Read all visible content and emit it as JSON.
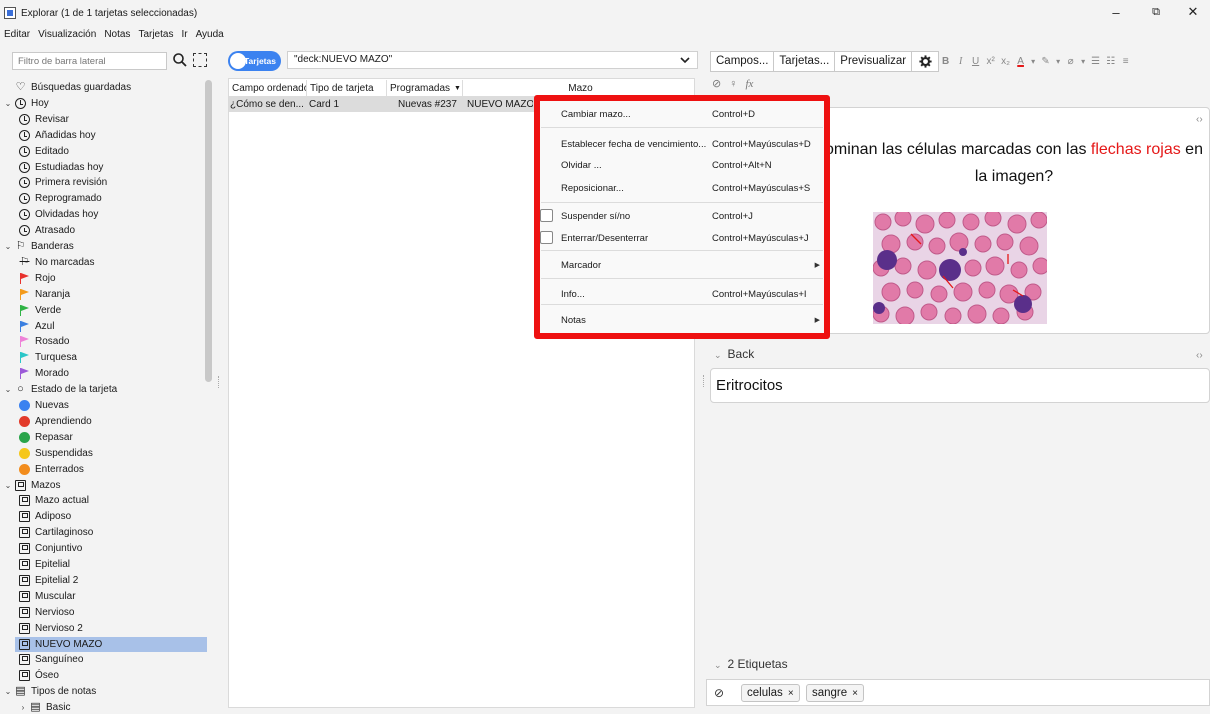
{
  "window": {
    "title": "Explorar (1 de 1 tarjetas seleccionadas)",
    "controls": {
      "minimize": "–",
      "maximize": "⧉",
      "close": "✕"
    }
  },
  "menubar": [
    "Editar",
    "Visualización",
    "Notas",
    "Tarjetas",
    "Ir",
    "Ayuda"
  ],
  "sidebar": {
    "filter_placeholder": "Filtro de barra lateral",
    "items": [
      {
        "label": "Búsquedas guardadas",
        "icon": "heart-icon",
        "level": 0
      },
      {
        "label": "Hoy",
        "icon": "clock-icon",
        "level": 0,
        "expandable": true
      },
      {
        "label": "Revisar",
        "icon": "clock-icon",
        "level": 1
      },
      {
        "label": "Añadidas hoy",
        "icon": "clock-icon",
        "level": 1
      },
      {
        "label": "Editado",
        "icon": "clock-icon",
        "level": 1
      },
      {
        "label": "Estudiadas hoy",
        "icon": "clock-icon",
        "level": 1
      },
      {
        "label": "Primera revisión",
        "icon": "clock-icon",
        "level": 1
      },
      {
        "label": "Reprogramado",
        "icon": "clock-icon",
        "level": 1
      },
      {
        "label": "Olvidadas hoy",
        "icon": "clock-icon",
        "level": 1
      },
      {
        "label": "Atrasado",
        "icon": "clock-icon",
        "level": 1
      },
      {
        "label": "Banderas",
        "icon": "flag-outline-icon",
        "level": 0,
        "expandable": true
      },
      {
        "label": "No marcadas",
        "icon": "no-flag-icon",
        "level": 1
      },
      {
        "label": "Rojo",
        "icon": "flag-icon",
        "color": "#e8322e",
        "level": 1
      },
      {
        "label": "Naranja",
        "icon": "flag-icon",
        "color": "#f39a1a",
        "level": 1
      },
      {
        "label": "Verde",
        "icon": "flag-icon",
        "color": "#2fb344",
        "level": 1
      },
      {
        "label": "Azul",
        "icon": "flag-icon",
        "color": "#3a7fe0",
        "level": 1
      },
      {
        "label": "Rosado",
        "icon": "flag-icon",
        "color": "#ee82d8",
        "level": 1
      },
      {
        "label": "Turquesa",
        "icon": "flag-icon",
        "color": "#2bc6c8",
        "level": 1
      },
      {
        "label": "Morado",
        "icon": "flag-icon",
        "color": "#9b5ad8",
        "level": 1
      },
      {
        "label": "Estado de la tarjeta",
        "icon": "circle-icon",
        "level": 0,
        "expandable": true
      },
      {
        "label": "Nuevas",
        "icon": "dot-icon",
        "color": "#3b82f0",
        "level": 1
      },
      {
        "label": "Aprendiendo",
        "icon": "dot-icon",
        "color": "#e23a2a",
        "level": 1
      },
      {
        "label": "Repasar",
        "icon": "dot-icon",
        "color": "#2aa44a",
        "level": 1
      },
      {
        "label": "Suspendidas",
        "icon": "dot-icon",
        "color": "#f5c71a",
        "level": 1
      },
      {
        "label": "Enterrados",
        "icon": "dot-icon",
        "color": "#f28c1c",
        "level": 1
      },
      {
        "label": "Mazos",
        "icon": "deck-icon",
        "level": 0,
        "expandable": true
      },
      {
        "label": "Mazo actual",
        "icon": "current-deck-icon",
        "level": 1
      },
      {
        "label": "Adiposo",
        "icon": "deck-icon",
        "level": 1
      },
      {
        "label": "Cartilaginoso",
        "icon": "deck-icon",
        "level": 1
      },
      {
        "label": "Conjuntivo",
        "icon": "deck-icon",
        "level": 1
      },
      {
        "label": "Epitelial",
        "icon": "deck-icon",
        "level": 1
      },
      {
        "label": "Epitelial 2",
        "icon": "deck-icon",
        "level": 1
      },
      {
        "label": "Muscular",
        "icon": "deck-icon",
        "level": 1
      },
      {
        "label": "Nervioso",
        "icon": "deck-icon",
        "level": 1
      },
      {
        "label": "Nervioso 2",
        "icon": "deck-icon",
        "level": 1
      },
      {
        "label": "NUEVO MAZO",
        "icon": "deck-icon",
        "level": 1,
        "selected": true
      },
      {
        "label": "Sanguíneo",
        "icon": "deck-icon",
        "level": 1
      },
      {
        "label": "Óseo",
        "icon": "deck-icon",
        "level": 1
      },
      {
        "label": "Tipos de notas",
        "icon": "note-type-icon",
        "level": 0,
        "expandable": true
      },
      {
        "label": "Basic",
        "icon": "note-type-icon",
        "level": 1,
        "collapsed": true
      }
    ]
  },
  "browser": {
    "mode_toggle": "Tarjetas",
    "search_query": "\"deck:NUEVO MAZO\"",
    "columns": [
      "Campo ordenado",
      "Tipo de tarjeta",
      "Programadas",
      "Mazo"
    ],
    "sort_indicator": "▼",
    "row": {
      "sort_field": "¿Cómo se den...",
      "card_type": "Card 1",
      "due": "Nuevas #237",
      "deck": "NUEVO MAZO"
    }
  },
  "context_menu": {
    "items": [
      {
        "label": "Cambiar mazo...",
        "shortcut": "Control+D"
      },
      {
        "label": "Establecer fecha de vencimiento...",
        "shortcut": "Control+Mayúsculas+D"
      },
      {
        "label": "Olvidar ...",
        "shortcut": "Control+Alt+N"
      },
      {
        "label": "Reposicionar...",
        "shortcut": "Control+Mayúsculas+S"
      },
      {
        "label": "Suspender sí/no",
        "shortcut": "Control+J",
        "checkbox": true
      },
      {
        "label": "Enterrar/Desenterrar",
        "shortcut": "Control+Mayúsculas+J",
        "checkbox": true
      },
      {
        "label": "Marcador",
        "shortcut": "",
        "submenu": true
      },
      {
        "label": "Info...",
        "shortcut": "Control+Mayúsculas+I"
      },
      {
        "label": "Notas",
        "shortcut": "",
        "submenu": true
      }
    ],
    "highlight_color": "#ee1111"
  },
  "editor": {
    "buttons": [
      "Campos...",
      "Tarjetas...",
      "Previsualizar"
    ],
    "format_glyphs": [
      "B",
      "I",
      "U",
      "x²",
      "x₂",
      "A",
      "▾",
      "✎",
      "▾",
      "⌀",
      "▾",
      "☰",
      "☷",
      "≡"
    ],
    "front_text_before": "ominan las células marcadas con las ",
    "front_text_red": "flechas rojas",
    "front_text_after": " en la imagen?",
    "back_label": "Back",
    "back_value": "Eritrocitos",
    "tags_label": "2 Etiquetas",
    "tags": [
      "celulas",
      "sangre"
    ]
  }
}
